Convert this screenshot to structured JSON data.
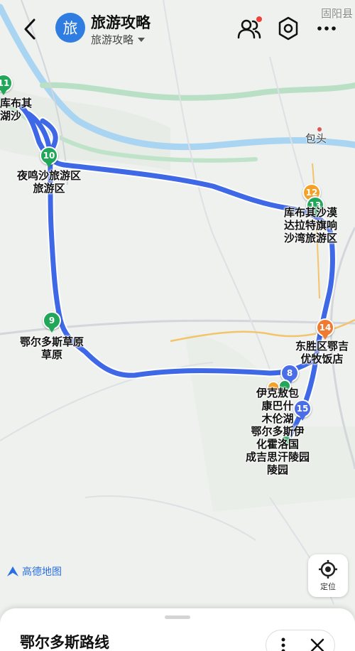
{
  "header": {
    "title": "旅游攻略",
    "subtitle": "旅游攻略",
    "avatar_char": "旅",
    "accent": "#2f7de1"
  },
  "icons": {
    "back": "back-arrow-icon",
    "people": "people-icon",
    "settings": "settings-icon",
    "more": "more-icon",
    "locate": "locate-icon"
  },
  "map": {
    "route_color": "#3e68e6",
    "cities": {
      "baotou": "包头",
      "guyang": "固阳县"
    },
    "pins": {
      "p11": "11",
      "p10": "10",
      "p9": "9",
      "p8": "8",
      "p12": "12",
      "p13": "13",
      "p14": "14",
      "p15": "15"
    },
    "pin_colors": {
      "green": "#22a659",
      "orange": "#f4a12a",
      "red_orange": "#ef7a32",
      "blue": "#4a6ee8"
    },
    "places": {
      "kubuqi_nw": [
        "库布其",
        "湖沙"
      ],
      "yemingsha": [
        "夜鸣沙旅游区",
        "旅游区"
      ],
      "ordos_grassland": [
        "鄂尔多斯草原",
        "草原"
      ],
      "kubuqi_ne": [
        "库布其沙漠",
        "达拉特旗响",
        "沙湾旅游区"
      ],
      "dongsheng": [
        "东胜区鄂吉",
        "优牧饭店"
      ],
      "cluster": [
        "伊克敖包",
        "康巴什",
        "木伦湖",
        "鄂尔多斯伊",
        "化霍洛国",
        "成吉思汗陵园",
        "陵园"
      ]
    },
    "logo": "高德地图",
    "locate_label": "定位"
  },
  "sheet": {
    "title": "鄂尔多斯路线"
  }
}
